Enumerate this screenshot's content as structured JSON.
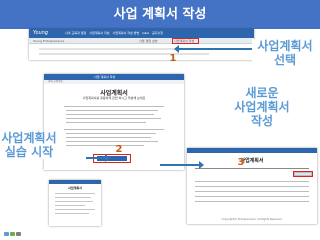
{
  "slide": {
    "title": "사업 계획서 작성"
  },
  "shot1": {
    "brand": "Young",
    "menu": [
      "나의 교육과 열정",
      "사업계획서 작성",
      "사업계획서 작성 방법",
      "Q&A",
      "공지사항"
    ],
    "crumb": "Young Entrepreneurs",
    "subitems": [
      "사업 경험 실습",
      "사업계획서 작성"
    ]
  },
  "shot2": {
    "header": "사업 계획서 작성",
    "subnav": "나의 교육과정",
    "doc_title": "사업계획서",
    "doc_subtitle": "사업계획서를 유용하게 관련 하시고 작성해 보세요"
  },
  "shot3": {
    "doc_title": "사업계획서",
    "footer": "Copyright(c) Entrepreneurs. All Rights Reserved."
  },
  "shot4": {
    "doc_title": "사업계획서"
  },
  "callouts": {
    "c1": "사업계획서\n선택",
    "c2": "사업계획서\n실습 시작",
    "c3": "새로운\n사업계획서\n작성",
    "n1": "1",
    "n2": "2",
    "n3": "3"
  },
  "colors": {
    "title_bg": "#4472c4",
    "callout_text": "#5b9bd5",
    "number": "#c55a11",
    "highlight": "#e02020",
    "nav": "#2e66ad"
  }
}
